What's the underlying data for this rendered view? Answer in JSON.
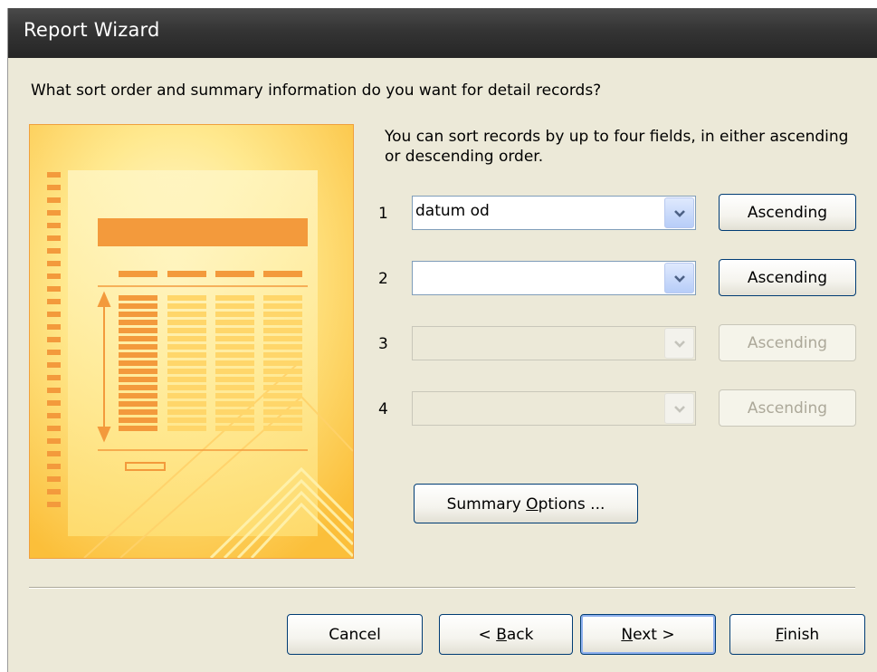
{
  "window": {
    "title": "Report Wizard"
  },
  "question": "What sort order and summary information do you want for detail records?",
  "hint": "You can sort records by up to four fields, in either ascending or descending order.",
  "sort_fields": [
    {
      "number": "1",
      "value": "datum od",
      "order": "Ascending",
      "enabled": true
    },
    {
      "number": "2",
      "value": "",
      "order": "Ascending",
      "enabled": true
    },
    {
      "number": "3",
      "value": "",
      "order": "Ascending",
      "enabled": false
    },
    {
      "number": "4",
      "value": "",
      "order": "Ascending",
      "enabled": false
    }
  ],
  "summary_button": {
    "before": "Summary ",
    "accel": "O",
    "after": "ptions ..."
  },
  "footer": {
    "cancel": "Cancel",
    "back": {
      "before": "< ",
      "accel": "B",
      "after": "ack"
    },
    "next": {
      "before": "",
      "accel": "N",
      "after": "ext >"
    },
    "finish": {
      "before": "",
      "accel": "F",
      "after": "inish"
    }
  },
  "colors": {
    "titlebar": "#343434",
    "dialog_bg": "#ece9d8",
    "button_border": "#003c74",
    "art_orange": "#f39a3c",
    "art_yellow": "#ffe07a"
  },
  "icons": [
    "chevron-down-icon",
    "report-illustration"
  ]
}
